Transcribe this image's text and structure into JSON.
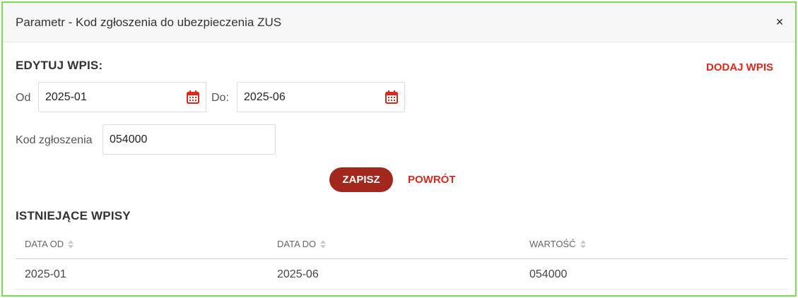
{
  "dialog": {
    "title": "Parametr - Kod zgłoszenia do ubezpieczenia ZUS",
    "close_glyph": "×"
  },
  "edit": {
    "heading": "EDYTUJ WPIS:",
    "add_link": "DODAJ WPIS",
    "from_label": "Od",
    "from_value": "2025-01",
    "to_label": "Do:",
    "to_value": "2025-06",
    "code_label": "Kod zgłoszenia",
    "code_value": "054000",
    "calendar_icon": "calendar-icon",
    "save_label": "ZAPISZ",
    "back_label": "POWRÓT"
  },
  "existing": {
    "heading": "ISTNIEJĄCE WPISY",
    "columns": [
      "DATA OD",
      "DATA DO",
      "WARTOŚĆ"
    ],
    "rows": [
      [
        "2025-01",
        "2025-06",
        "054000"
      ]
    ]
  },
  "colors": {
    "accent": "#d72a1e",
    "button": "#a2271d",
    "border": "#7ed957"
  }
}
